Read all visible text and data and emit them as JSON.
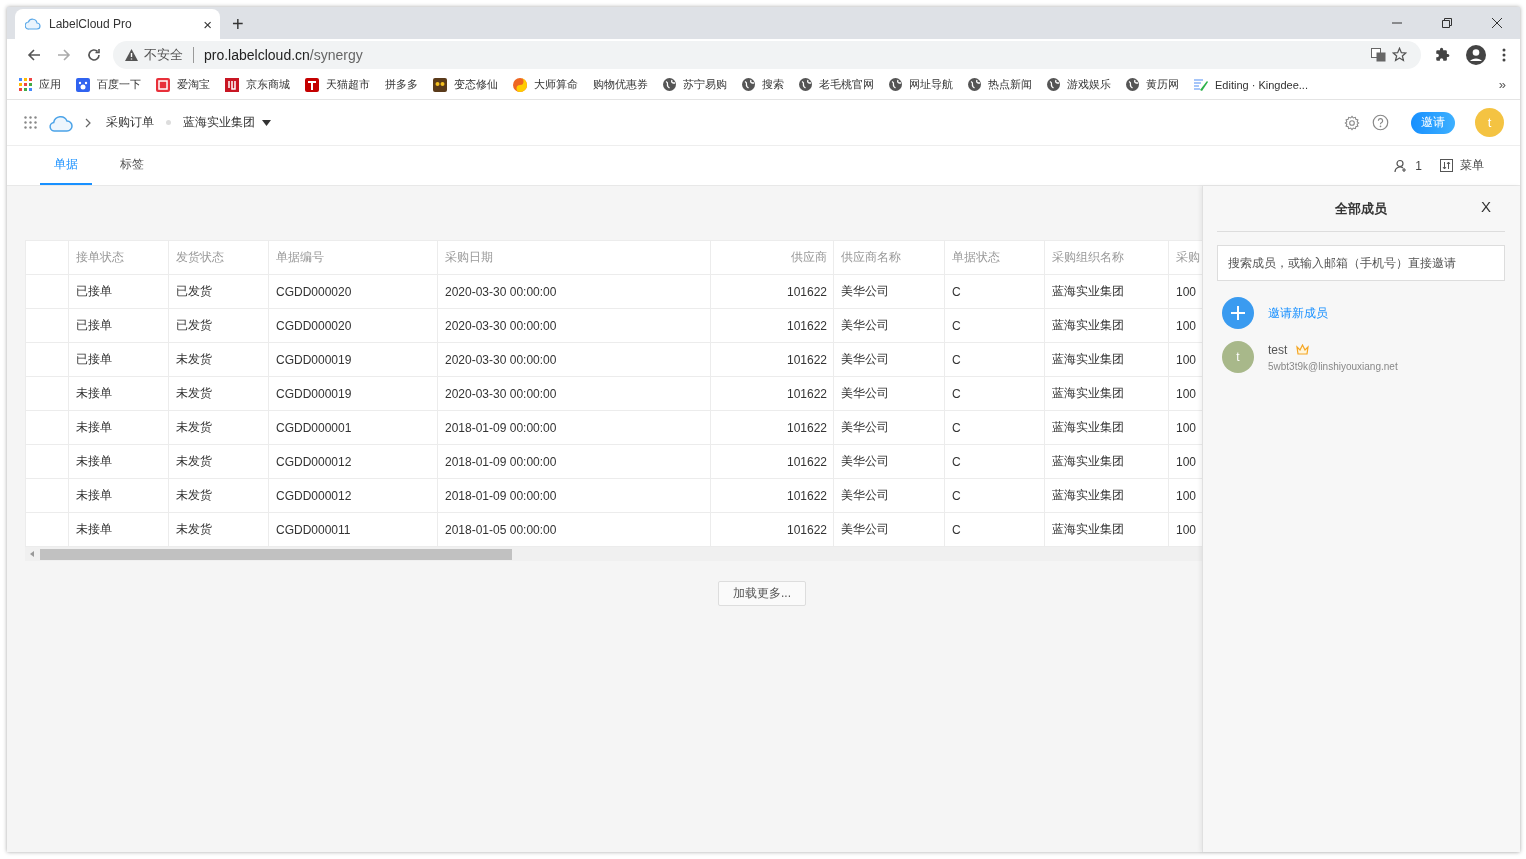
{
  "browser": {
    "tab_title": "LabelCloud Pro",
    "tab_close": "×",
    "new_tab": "+",
    "security": "不安全",
    "url_host": "pro.labelcloud.cn",
    "url_path": "/synergy",
    "more_bookmarks": "»"
  },
  "bookmarks": [
    {
      "kind": "apps",
      "label": "应用"
    },
    {
      "kind": "paw",
      "label": "百度一下"
    },
    {
      "kind": "tao",
      "label": "爱淘宝"
    },
    {
      "kind": "jd",
      "label": "京东商城"
    },
    {
      "kind": "tmall",
      "label": "天猫超市"
    },
    {
      "kind": "none",
      "label": "拼多多"
    },
    {
      "kind": "owl",
      "label": "变态修仙"
    },
    {
      "kind": "yin",
      "label": "大师算命"
    },
    {
      "kind": "none",
      "label": "购物优惠券"
    },
    {
      "kind": "globe",
      "label": "苏宁易购"
    },
    {
      "kind": "globe",
      "label": "搜索"
    },
    {
      "kind": "globe",
      "label": "老毛桃官网"
    },
    {
      "kind": "globe",
      "label": "网址导航"
    },
    {
      "kind": "globe",
      "label": "热点新闻"
    },
    {
      "kind": "globe",
      "label": "游戏娱乐"
    },
    {
      "kind": "globe",
      "label": "黄历网"
    },
    {
      "kind": "edit",
      "label": "Editing · Kingdee..."
    }
  ],
  "header": {
    "breadcrumb": "采购订单",
    "org": "蓝海实业集团",
    "invite": "邀请",
    "avatar": "t"
  },
  "tabs": [
    {
      "label": "单据",
      "selected": true
    },
    {
      "label": "标签",
      "selected": false
    }
  ],
  "toolbar": {
    "members": "1",
    "menu": "菜单"
  },
  "table": {
    "columns": [
      "接单状态",
      "发货状态",
      "单据编号",
      "采购日期",
      "供应商",
      "供应商名称",
      "单据状态",
      "采购组织名称",
      "采购"
    ],
    "rows": [
      [
        "已接单",
        "已发货",
        "CGDD000020",
        "2020-03-30 00:00:00",
        "101622",
        "美华公司",
        "C",
        "蓝海实业集团",
        "100"
      ],
      [
        "已接单",
        "已发货",
        "CGDD000020",
        "2020-03-30 00:00:00",
        "101622",
        "美华公司",
        "C",
        "蓝海实业集团",
        "100"
      ],
      [
        "已接单",
        "未发货",
        "CGDD000019",
        "2020-03-30 00:00:00",
        "101622",
        "美华公司",
        "C",
        "蓝海实业集团",
        "100"
      ],
      [
        "未接单",
        "未发货",
        "CGDD000019",
        "2020-03-30 00:00:00",
        "101622",
        "美华公司",
        "C",
        "蓝海实业集团",
        "100"
      ],
      [
        "未接单",
        "未发货",
        "CGDD000001",
        "2018-01-09 00:00:00",
        "101622",
        "美华公司",
        "C",
        "蓝海实业集团",
        "100"
      ],
      [
        "未接单",
        "未发货",
        "CGDD000012",
        "2018-01-09 00:00:00",
        "101622",
        "美华公司",
        "C",
        "蓝海实业集团",
        "100"
      ],
      [
        "未接单",
        "未发货",
        "CGDD000012",
        "2018-01-09 00:00:00",
        "101622",
        "美华公司",
        "C",
        "蓝海实业集团",
        "100"
      ],
      [
        "未接单",
        "未发货",
        "CGDD000011",
        "2018-01-05 00:00:00",
        "101622",
        "美华公司",
        "C",
        "蓝海实业集团",
        "100"
      ]
    ]
  },
  "load_more": "加载更多...",
  "panel": {
    "title": "全部成员",
    "close": "X",
    "search_placeholder": "搜索成员，或输入邮箱（手机号）直接邀请",
    "invite_new": "邀请新成员",
    "members": [
      {
        "avatar": "t",
        "name": "test",
        "email": "5wbt3t9k@linshiyouxiang.net",
        "owner": true
      }
    ]
  }
}
